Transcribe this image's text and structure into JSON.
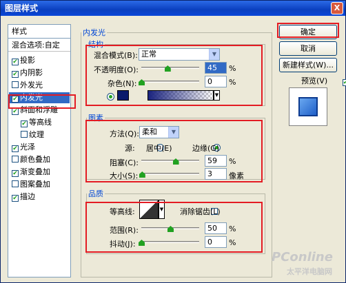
{
  "window": {
    "title": "图层样式",
    "close": "X"
  },
  "sidebar": {
    "header": "样式",
    "blend_options": "混合选项:自定",
    "items": [
      {
        "label": "投影",
        "checked": true
      },
      {
        "label": "内阴影",
        "checked": true
      },
      {
        "label": "外发光",
        "checked": false
      },
      {
        "label": "内发光",
        "checked": true,
        "selected": true
      },
      {
        "label": "斜面和浮雕",
        "checked": true
      },
      {
        "label": "等高线",
        "checked": true
      },
      {
        "label": "纹理",
        "checked": false
      },
      {
        "label": "光泽",
        "checked": true
      },
      {
        "label": "颜色叠加",
        "checked": false
      },
      {
        "label": "渐变叠加",
        "checked": true
      },
      {
        "label": "图案叠加",
        "checked": false
      },
      {
        "label": "描边",
        "checked": true
      }
    ]
  },
  "panel": {
    "title": "内发光",
    "structure": {
      "title": "结构",
      "blend_mode_label": "混合模式(B):",
      "blend_mode_value": "正常",
      "opacity_label": "不透明度(O):",
      "opacity_value": "45",
      "opacity_unit": "%",
      "opacity_pct": 45,
      "noise_label": "杂色(N):",
      "noise_value": "0",
      "noise_unit": "%",
      "noise_pct": 0,
      "color_swatch": "#0a1a6b"
    },
    "elements": {
      "title": "图素",
      "method_label": "方法(Q):",
      "method_value": "柔和",
      "source_label": "源:",
      "source_center": "居中(E)",
      "source_edge": "边缘(G)",
      "choke_label": "阻塞(C):",
      "choke_value": "59",
      "choke_unit": "%",
      "choke_pct": 59,
      "size_label": "大小(S):",
      "size_value": "3",
      "size_unit": "像素",
      "size_pct": 1
    },
    "quality": {
      "title": "品质",
      "contour_label": "等高线:",
      "antialias_label": "消除锯齿(L)",
      "range_label": "范围(R):",
      "range_value": "50",
      "range_unit": "%",
      "range_pct": 50,
      "jitter_label": "抖动(J):",
      "jitter_value": "0",
      "jitter_unit": "%",
      "jitter_pct": 0
    }
  },
  "buttons": {
    "ok": "确定",
    "cancel": "取消",
    "new_style": "新建样式(W)...",
    "preview": "预览(V)"
  },
  "watermark": {
    "brand": "PConline",
    "sub": "太平洋电脑网"
  },
  "colors": {
    "annotation_red": "#e31b23",
    "accent_blue": "#0046d5"
  }
}
